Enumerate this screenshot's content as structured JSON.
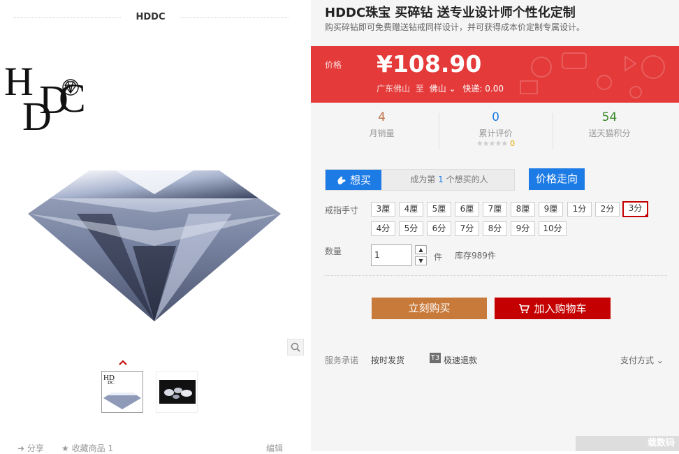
{
  "gallery": {
    "shop_name": "HDDC",
    "zoom_icon": "search-icon",
    "nav_arrow_icon": "chevron-up-icon",
    "share_label": "分享",
    "favorite_label": "收藏商品",
    "favorite_count": "1",
    "edit_label": "编辑"
  },
  "product": {
    "title": "HDDC珠宝 买碎钻 送专业设计师个性化定制",
    "subtitle": "购买碎钻即可免费赠送钻戒同样设计，并可获得成本价定制专属设计。",
    "price_label": "价格",
    "price": "¥108.90",
    "origin": "广东佛山",
    "to_label": "至",
    "destination": "佛山",
    "shipping": "快递: 0.00"
  },
  "stats": [
    {
      "value": "4",
      "label": "月销量",
      "color": "#c0714a"
    },
    {
      "value": "0",
      "label": "累计评价",
      "color": "#1d7be5"
    },
    {
      "value": "54",
      "label": "送天猫积分",
      "color": "#3c8a2a"
    }
  ],
  "rating": {
    "stars": "★★★★★",
    "count": "0"
  },
  "want": {
    "button": "想买",
    "text_prefix": "成为第",
    "rank": "1",
    "text_suffix": "个想买的人",
    "trend_button": "价格走向"
  },
  "ring_size": {
    "label": "戒指手寸",
    "options": [
      "3厘",
      "4厘",
      "5厘",
      "6厘",
      "7厘",
      "8厘",
      "9厘",
      "1分",
      "2分",
      "3分",
      "4分",
      "5分",
      "6分",
      "7分",
      "8分",
      "9分",
      "10分"
    ],
    "selected": "3分"
  },
  "quantity": {
    "label": "数量",
    "value": "1",
    "unit": "件",
    "stock": "库存989件"
  },
  "actions": {
    "buy_now": "立刻购买",
    "add_to_cart": "加入购物车"
  },
  "service": {
    "label": "服务承诺",
    "item1": "按时发货",
    "badge": "T3",
    "item2": "极速退款",
    "payment": "支付方式"
  },
  "watermark": "载数码"
}
